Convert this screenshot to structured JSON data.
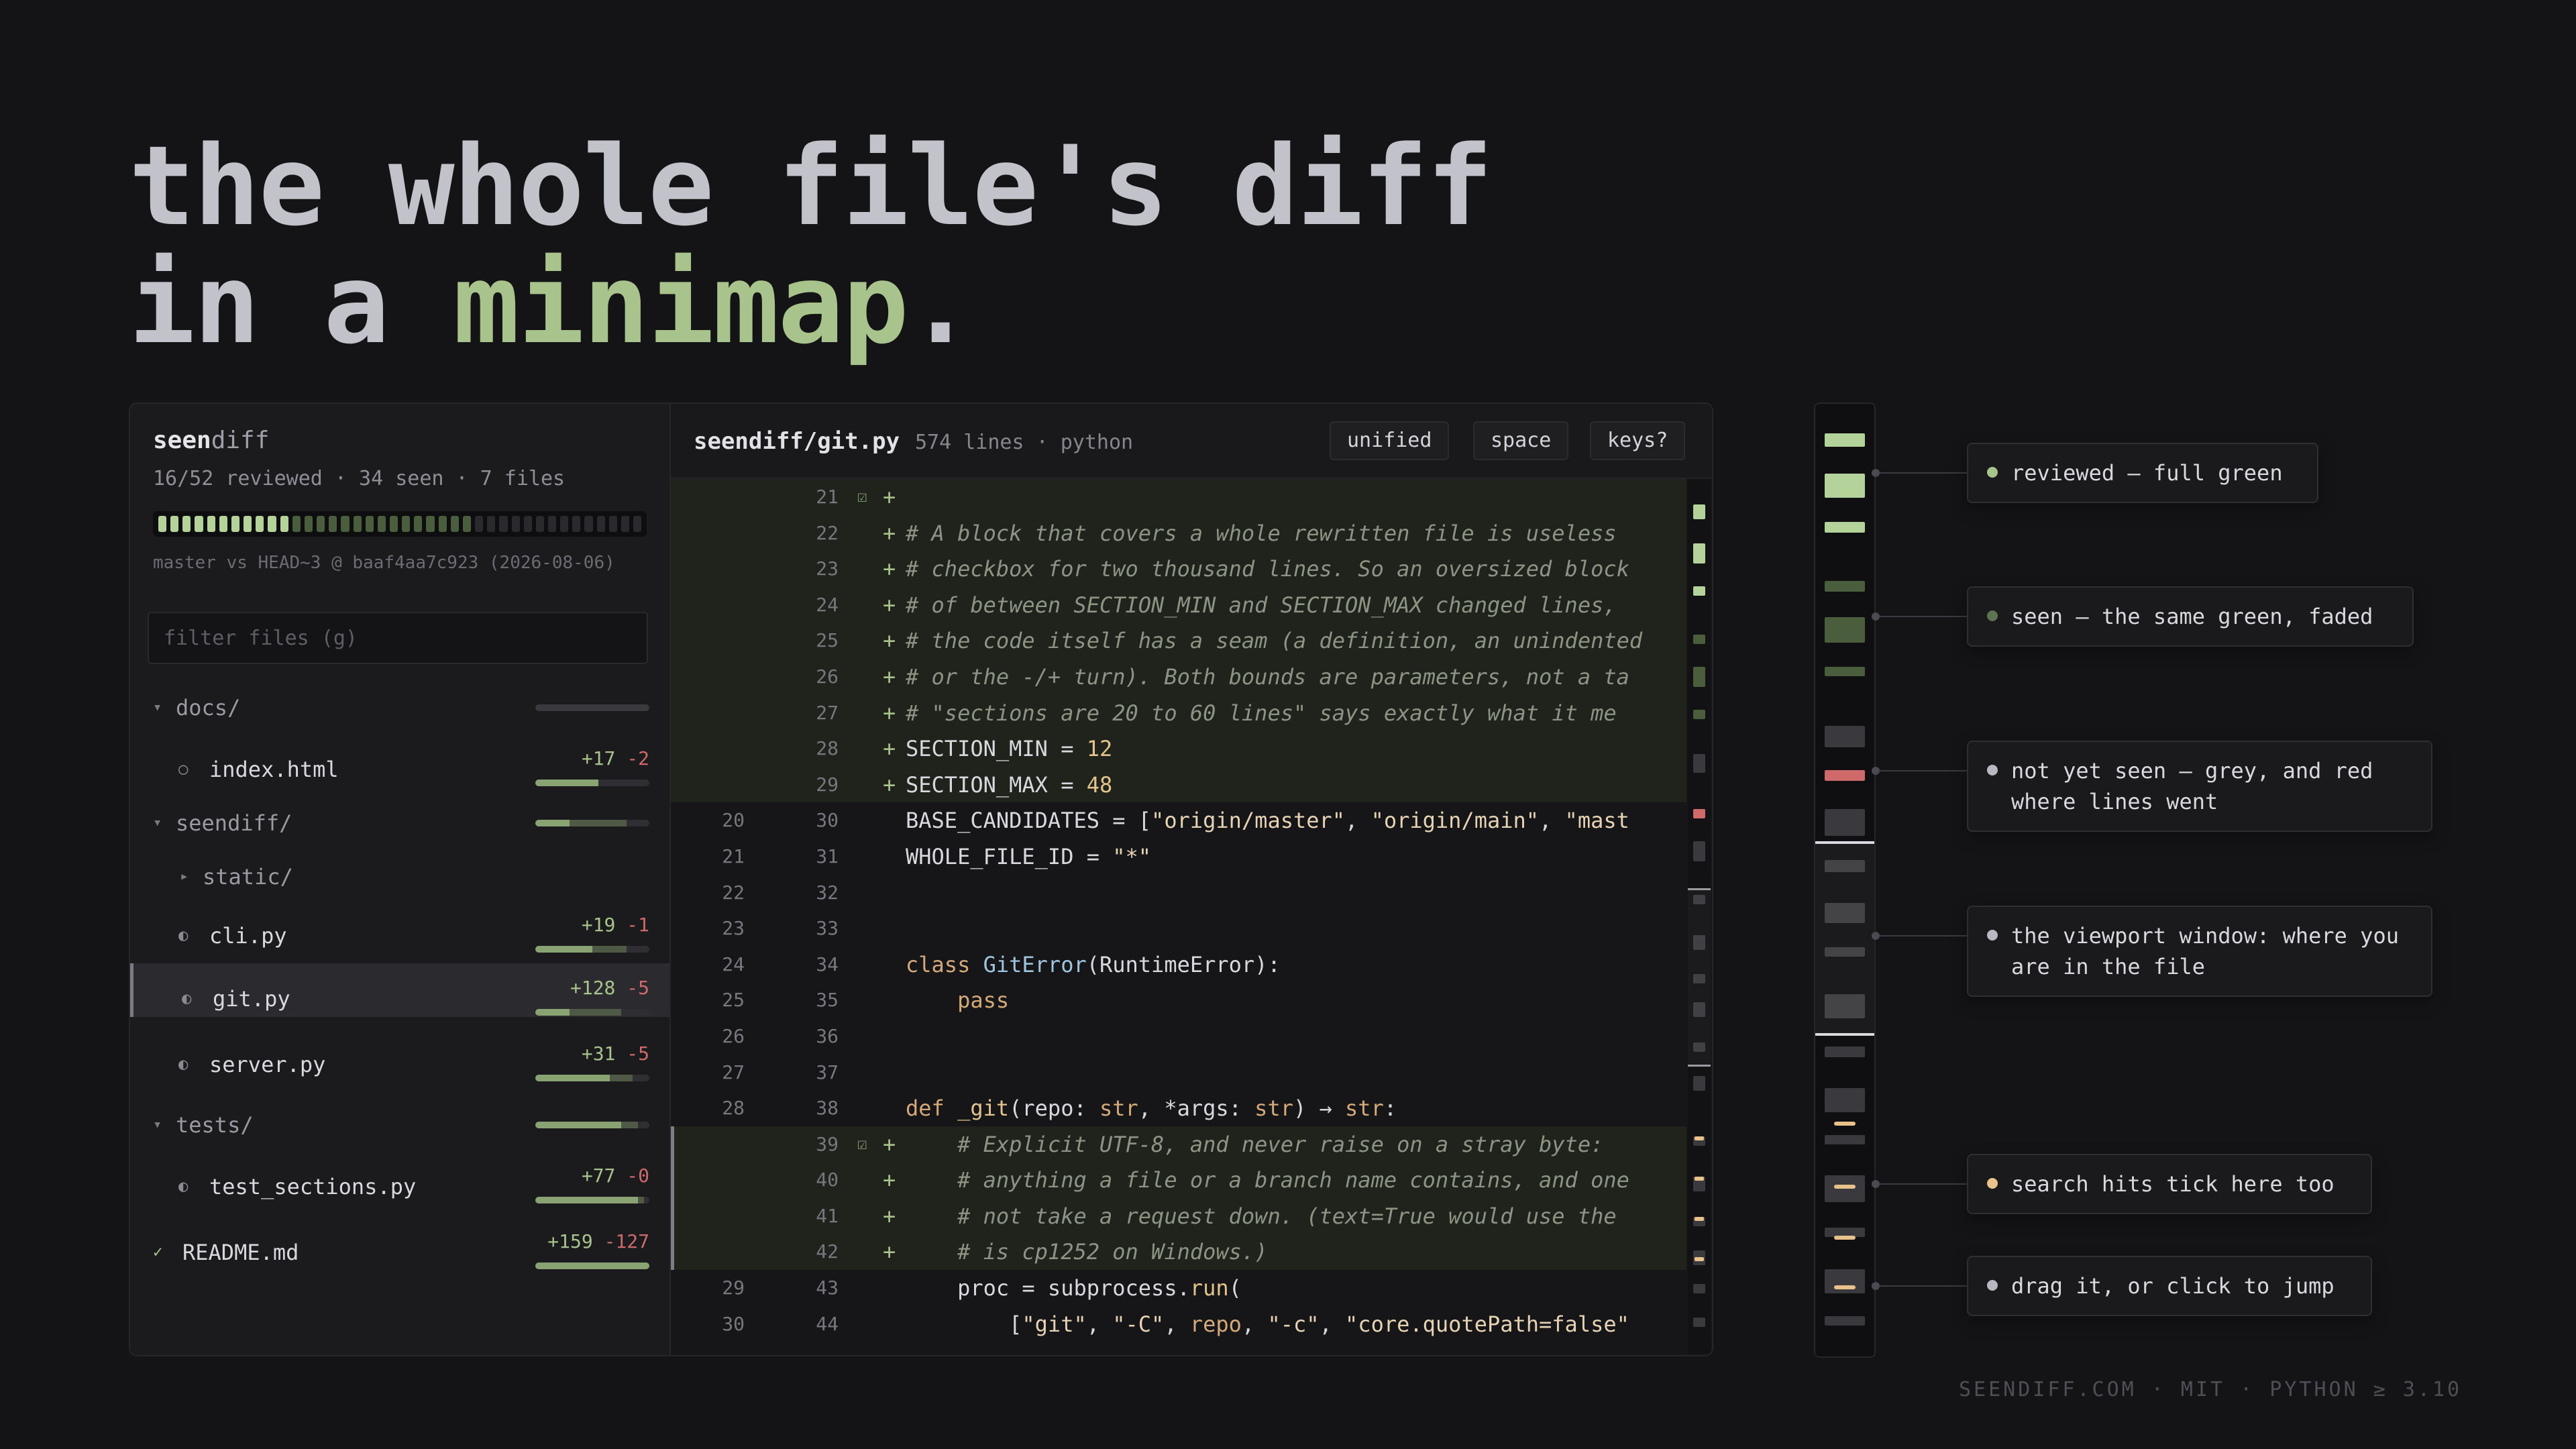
{
  "headline": {
    "line1": "the whole file's diff",
    "line2_prefix": "in a ",
    "line2_accent": "minimap",
    "line2_suffix": "."
  },
  "colors": {
    "accent": "#a8c48c",
    "removed": "#d06a6a",
    "search": "#e8c28a",
    "seen": "#4a5e3e",
    "unseen": "#3a3a3e"
  },
  "sidebar": {
    "app_name_bold": "seen",
    "app_name_rest": "diff",
    "stats": "16/52 reviewed · 34 seen · 7 files",
    "progress": {
      "reviewed": 16,
      "seen": 34,
      "total": 52
    },
    "ref": "master vs HEAD~3 @ baaf4aa7c923 (2026-08-06)",
    "filter_placeholder": "filter files (g)",
    "tree": [
      {
        "kind": "dir",
        "caret": "▾",
        "label": "docs/",
        "level": 0,
        "bar": {
          "reviewed": 0.0,
          "seen": 0.0
        }
      },
      {
        "kind": "file",
        "status": "○",
        "label": "index.html",
        "level": 1,
        "add": "+17",
        "del": "-2",
        "bar": {
          "reviewed": 0.55,
          "seen": 0.0
        }
      },
      {
        "kind": "dir",
        "caret": "▾",
        "label": "seendiff/",
        "level": 0,
        "bar": {
          "reviewed": 0.3,
          "seen": 0.5
        }
      },
      {
        "kind": "dir",
        "caret": "▸",
        "label": "static/",
        "level": 1
      },
      {
        "kind": "file",
        "status": "◐",
        "label": "cli.py",
        "level": 1,
        "add": "+19",
        "del": "-1",
        "bar": {
          "reviewed": 0.5,
          "seen": 0.3
        }
      },
      {
        "kind": "file",
        "status": "◐",
        "label": "git.py",
        "level": 1,
        "add": "+128",
        "del": "-5",
        "active": true,
        "bar": {
          "reviewed": 0.3,
          "seen": 0.45
        }
      },
      {
        "kind": "file",
        "status": "◐",
        "label": "server.py",
        "level": 1,
        "add": "+31",
        "del": "-5",
        "bar": {
          "reviewed": 0.65,
          "seen": 0.2
        }
      },
      {
        "kind": "dir",
        "caret": "▾",
        "label": "tests/",
        "level": 0,
        "bar": {
          "reviewed": 0.75,
          "seen": 0.15
        }
      },
      {
        "kind": "file",
        "status": "◐",
        "label": "test_sections.py",
        "level": 1,
        "add": "+77",
        "del": "-0",
        "bar": {
          "reviewed": 0.9,
          "seen": 0.05
        }
      },
      {
        "kind": "file",
        "status": "✓",
        "label": "README.md",
        "level": 0,
        "add": "+159",
        "del": "-127",
        "bar": {
          "reviewed": 1.0,
          "seen": 0.0
        }
      }
    ]
  },
  "editor": {
    "file_path": "seendiff/git.py",
    "file_info": "574 lines · python",
    "buttons": [
      "unified",
      "space",
      "keys?"
    ],
    "lines": [
      {
        "old": "",
        "new": "21",
        "type": "add",
        "check": "☑",
        "html": ""
      },
      {
        "old": "",
        "new": "22",
        "type": "add",
        "html": "<span class='cmt'># A block that covers a whole rewritten file is useless</span>"
      },
      {
        "old": "",
        "new": "23",
        "type": "add",
        "html": "<span class='cmt'># checkbox for two thousand lines. So an oversized block</span>"
      },
      {
        "old": "",
        "new": "24",
        "type": "add",
        "html": "<span class='cmt'># of between SECTION_MIN and SECTION_MAX changed lines,</span>"
      },
      {
        "old": "",
        "new": "25",
        "type": "add",
        "html": "<span class='cmt'># the code itself has a seam (a definition, an unindented</span>"
      },
      {
        "old": "",
        "new": "26",
        "type": "add",
        "html": "<span class='cmt'># or the -/+ turn). Both bounds are parameters, not a ta</span>"
      },
      {
        "old": "",
        "new": "27",
        "type": "add",
        "html": "<span class='cmt'># \"sections are 20 to 60 lines\" says exactly what it me</span>"
      },
      {
        "old": "",
        "new": "28",
        "type": "add",
        "html": "<span class='var'>SECTION_MIN</span> = <span class='num'>12</span>"
      },
      {
        "old": "",
        "new": "29",
        "type": "add",
        "html": "<span class='var'>SECTION_MAX</span> = <span class='num'>48</span>"
      },
      {
        "old": "20",
        "new": "30",
        "type": "ctx",
        "html": "<span class='var'>BASE_CANDIDATES</span> = [<span class='str'>\"origin/master\"</span>, <span class='str'>\"origin/main\"</span>, <span class='str'>\"mast</span>"
      },
      {
        "old": "21",
        "new": "31",
        "type": "ctx",
        "html": "<span class='var'>WHOLE_FILE_ID</span> = <span class='str'>\"*\"</span>"
      },
      {
        "old": "22",
        "new": "32",
        "type": "ctx",
        "html": ""
      },
      {
        "old": "23",
        "new": "33",
        "type": "ctx",
        "html": ""
      },
      {
        "old": "24",
        "new": "34",
        "type": "ctx",
        "html": "<span class='kw'>class</span> <span class='cls'>GitError</span>(RuntimeError):"
      },
      {
        "old": "25",
        "new": "35",
        "type": "ctx",
        "html": "    <span class='kw'>pass</span>"
      },
      {
        "old": "26",
        "new": "36",
        "type": "ctx",
        "html": ""
      },
      {
        "old": "27",
        "new": "37",
        "type": "ctx",
        "html": ""
      },
      {
        "old": "28",
        "new": "38",
        "type": "ctx",
        "html": "<span class='kw'>def</span> <span class='fn'>_git</span>(repo: <span class='tp'>str</span>, *args: <span class='tp'>str</span>) → <span class='tp'>str</span>:"
      },
      {
        "old": "",
        "new": "39",
        "type": "add",
        "check": "☑",
        "sel": true,
        "html": "    <span class='cmt'># Explicit UTF-8, and never raise on a stray byte: </span>"
      },
      {
        "old": "",
        "new": "40",
        "type": "add",
        "sel": true,
        "html": "    <span class='cmt'># anything a file or a branch name contains, and one</span>"
      },
      {
        "old": "",
        "new": "41",
        "type": "add",
        "sel": true,
        "html": "    <span class='cmt'># not take a request down. (text=True would use the</span>"
      },
      {
        "old": "",
        "new": "42",
        "type": "add",
        "sel": true,
        "html": "    <span class='cmt'># is cp1252 on Windows.)</span>"
      },
      {
        "old": "29",
        "new": "43",
        "type": "ctx",
        "html": "    proc = subprocess.<span class='fn'>run</span>("
      },
      {
        "old": "30",
        "new": "44",
        "type": "ctx",
        "html": "        [<span class='str'>\"git\"</span>, <span class='str'>\"-C\"</span>, <span class='tp'>repo</span>, <span class='str'>\"-c\"</span>, <span class='str'>\"core.quotePath=false\"</span>"
      }
    ]
  },
  "callouts": [
    {
      "text": "reviewed — full green",
      "dot": "#a8c48c"
    },
    {
      "text": "seen — the same green, faded",
      "dot": "#5e7450"
    },
    {
      "text": "not yet seen — grey, and red where lines went",
      "dot": "#b8b8c0"
    },
    {
      "text": "the viewport window: where you are in the file",
      "dot": "#b8b8c0"
    },
    {
      "text": "search hits tick here too",
      "dot": "#e8c28a"
    },
    {
      "text": "drag it, or click to jump",
      "dot": "#b8b8c0"
    }
  ],
  "footer": "SEENDIFF.COM · MIT · PYTHON ≥ 3.10"
}
